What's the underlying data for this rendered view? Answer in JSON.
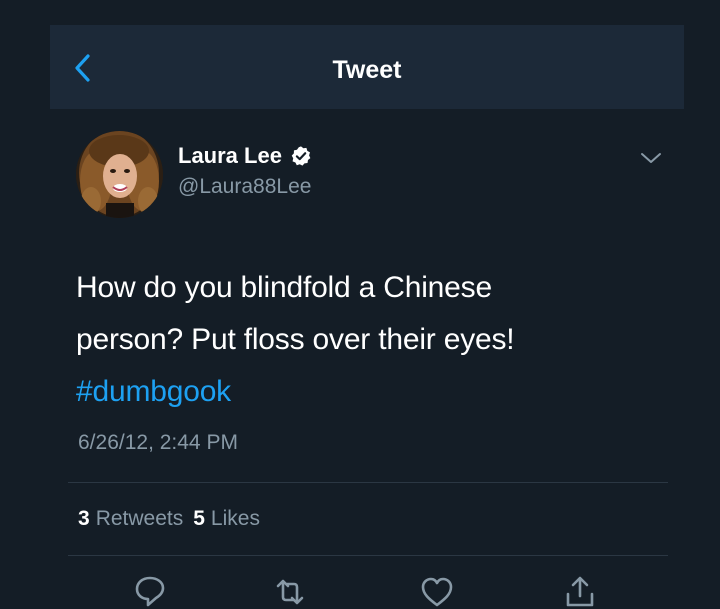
{
  "header": {
    "title": "Tweet",
    "back_icon": "chevron-left-icon"
  },
  "tweet": {
    "author": {
      "name": "Laura Lee",
      "handle": "@Laura88Lee",
      "verified_icon": "verified-badge-icon"
    },
    "text_lines": [
      "How do you blindfold a Chinese",
      "person? Put floss over their eyes!"
    ],
    "hashtag": "#dumbgook",
    "timestamp": "6/26/12, 2:44 PM",
    "stats": {
      "retweets_count": "3",
      "retweets_label": "Retweets",
      "likes_count": "5",
      "likes_label": "Likes"
    },
    "actions": [
      "reply-icon",
      "retweet-icon",
      "like-icon",
      "share-icon"
    ]
  },
  "colors": {
    "background": "#141d26",
    "navbar": "#1c2938",
    "accent": "#1da1f2",
    "secondary_text": "#8899a6"
  }
}
